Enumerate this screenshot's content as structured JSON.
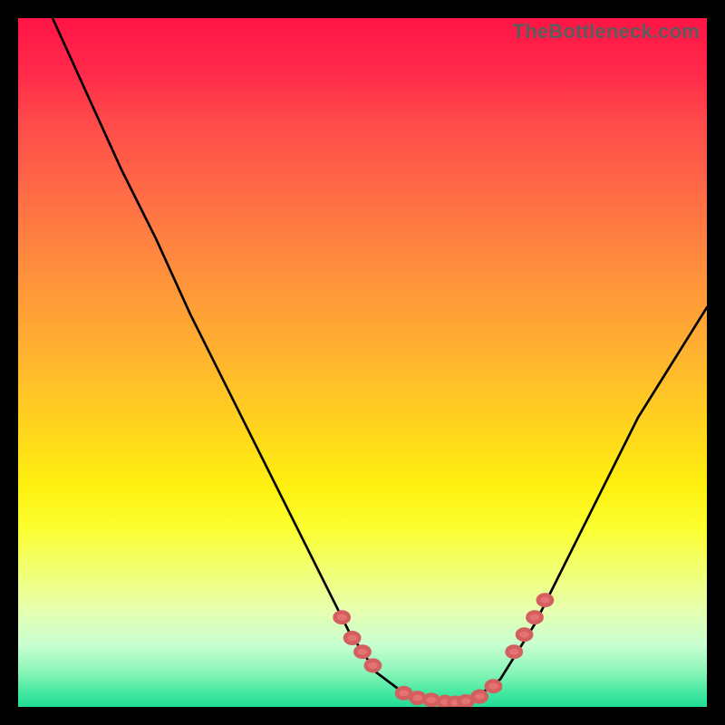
{
  "watermark": "TheBottleneck.com",
  "chart_data": {
    "type": "line",
    "title": "",
    "xlabel": "",
    "ylabel": "",
    "xlim": [
      0,
      100
    ],
    "ylim": [
      0,
      100
    ],
    "grid": false,
    "series": [
      {
        "name": "curve",
        "x": [
          5,
          10,
          15,
          20,
          25,
          30,
          35,
          40,
          45,
          48,
          50,
          52,
          56,
          60,
          63,
          66,
          70,
          75,
          80,
          85,
          90,
          95,
          100
        ],
        "y": [
          100,
          89,
          78,
          68,
          57,
          47,
          37,
          27,
          17,
          11,
          8,
          5,
          2,
          1,
          0.5,
          1,
          4,
          12,
          22,
          32,
          42,
          50,
          58
        ]
      }
    ],
    "markers": {
      "name": "highlighted-points",
      "points": [
        {
          "x": 47,
          "y": 13
        },
        {
          "x": 48.5,
          "y": 10
        },
        {
          "x": 50,
          "y": 8
        },
        {
          "x": 51.5,
          "y": 6
        },
        {
          "x": 56,
          "y": 2
        },
        {
          "x": 58,
          "y": 1.3
        },
        {
          "x": 60,
          "y": 1
        },
        {
          "x": 62,
          "y": 0.7
        },
        {
          "x": 63.5,
          "y": 0.6
        },
        {
          "x": 65,
          "y": 0.8
        },
        {
          "x": 67,
          "y": 1.5
        },
        {
          "x": 69,
          "y": 3
        },
        {
          "x": 72,
          "y": 8
        },
        {
          "x": 73.5,
          "y": 10.5
        },
        {
          "x": 75,
          "y": 13
        },
        {
          "x": 76.5,
          "y": 15.5
        }
      ]
    },
    "color_scale_note": "vertical gradient red(top) → orange → yellow → green(bottom)"
  },
  "colors": {
    "frame": "#000000",
    "curve": "#000000",
    "marker": "#e57373",
    "watermark": "#5c5c5c"
  }
}
